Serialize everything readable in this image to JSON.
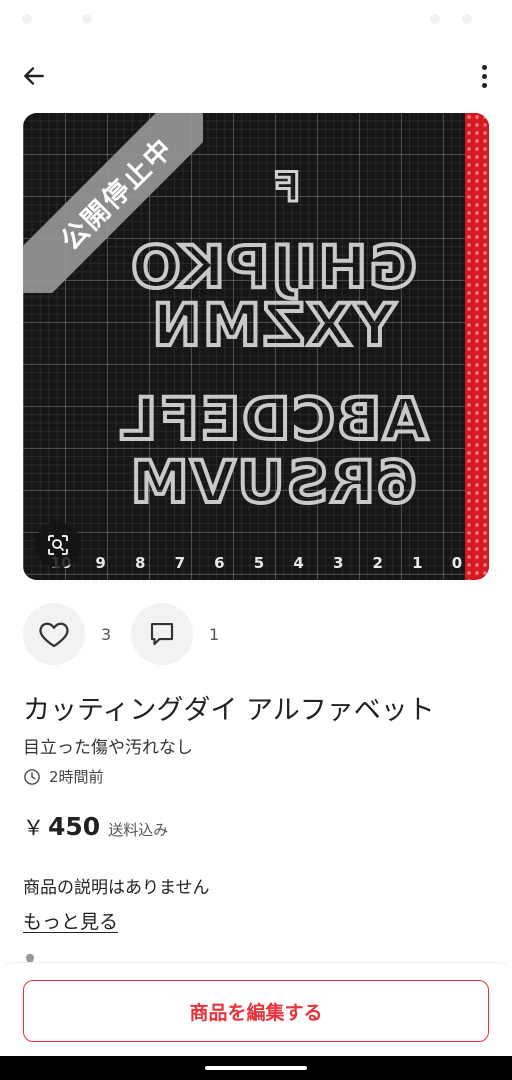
{
  "colors": {
    "accent": "#e8323c",
    "text": "#222222",
    "muted": "#555555",
    "banner": "#969696"
  },
  "image": {
    "banner_text": "公開停止中",
    "zoom_icon": "zoom-scan-icon",
    "ruler_numbers": [
      "10",
      "9",
      "8",
      "7",
      "6",
      "5",
      "4",
      "3",
      "2",
      "1",
      "0"
    ]
  },
  "reactions": {
    "like_count": "3",
    "comment_count": "1"
  },
  "product": {
    "title": "カッティングダイ アルファベット",
    "condition": "目立った傷や汚れなし",
    "posted_time": "2時間前",
    "price_currency": "￥",
    "price": "450",
    "shipping": "送料込み",
    "description": "商品の説明はありません",
    "more_label": "もっと見る"
  },
  "actions": {
    "edit_label": "商品を編集する"
  }
}
